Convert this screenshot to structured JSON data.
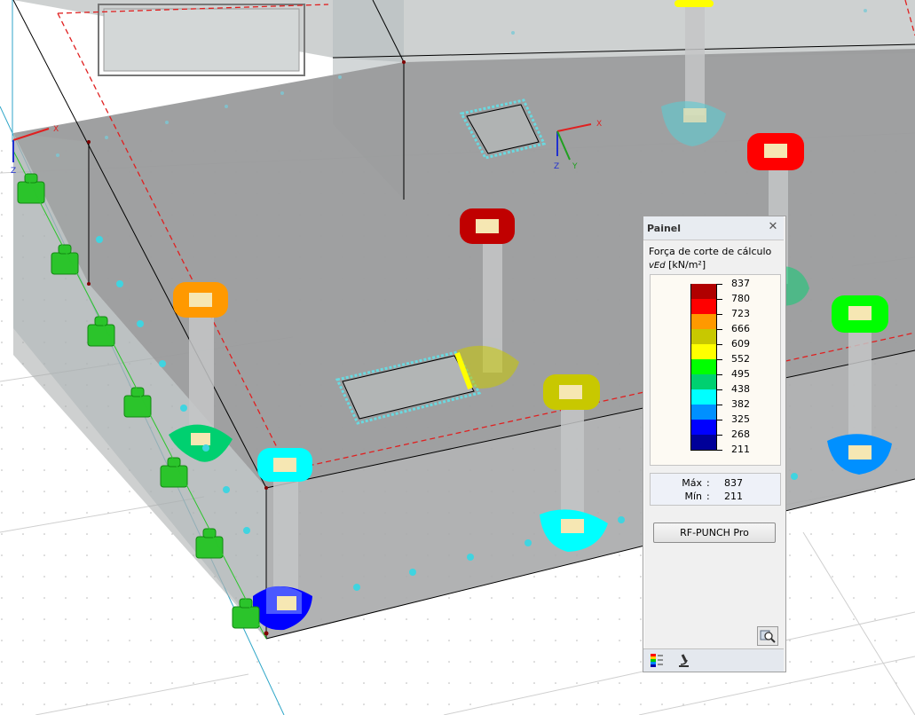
{
  "scene": {
    "axes_left": {
      "x": "X",
      "z": "Z"
    },
    "axes_center": {
      "x": "X",
      "y": "Y",
      "z": "Z"
    },
    "colors": {
      "background": "#ffffff",
      "slab": "#9a9b9c",
      "support": "#2bc42b",
      "member_lines": "#000000",
      "boundary_dashed": "#e02020",
      "grid_lines": "#2fa6c8"
    }
  },
  "panel": {
    "title": "Painel",
    "close_icon": "close-icon",
    "heading": "Força de corte de cálculo",
    "unit_symbol": "vEd",
    "unit": "[kN/m²]",
    "scale": [
      {
        "value": "837",
        "color": "#b00000"
      },
      {
        "value": "780",
        "color": "#ff0000"
      },
      {
        "value": "723",
        "color": "#ff9900"
      },
      {
        "value": "666",
        "color": "#c8c800"
      },
      {
        "value": "609",
        "color": "#ffff00"
      },
      {
        "value": "552",
        "color": "#00ff00"
      },
      {
        "value": "495",
        "color": "#00d070"
      },
      {
        "value": "438",
        "color": "#00ffff"
      },
      {
        "value": "382",
        "color": "#0090ff"
      },
      {
        "value": "325",
        "color": "#0000ff"
      },
      {
        "value": "268",
        "color": "#000099"
      },
      {
        "value": "211",
        "color": ""
      }
    ],
    "max_label": "Máx",
    "max_value": "837",
    "min_label": "Mín",
    "min_value": "211",
    "button_label": "RF-PUNCH Pro",
    "zoom_icon": "zoom-icon",
    "footer_icons": [
      "color-scale-icon",
      "microscope-icon"
    ]
  }
}
